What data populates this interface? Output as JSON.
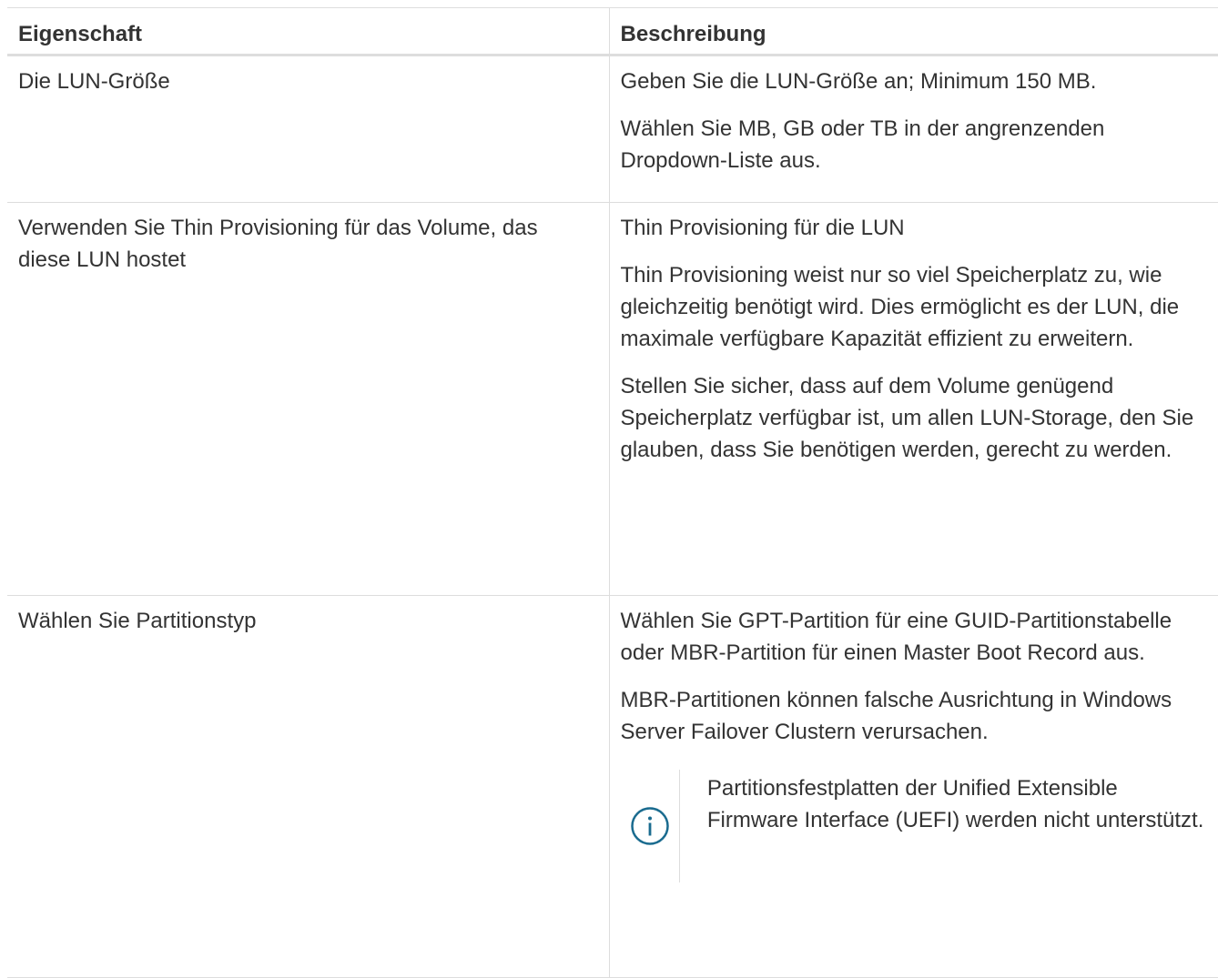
{
  "table": {
    "headers": [
      "Eigenschaft",
      "Beschreibung"
    ],
    "rows": [
      {
        "property": "Die LUN-Größe",
        "description": [
          "Geben Sie die LUN-Größe an; Minimum 150 MB.",
          "Wählen Sie MB, GB oder TB in der angrenzenden Dropdown-Liste aus."
        ]
      },
      {
        "property": "Verwenden Sie Thin Provisioning für das Volume, das diese LUN hostet",
        "description": [
          "Thin Provisioning für die LUN",
          "Thin Provisioning weist nur so viel Speicherplatz zu, wie gleichzeitig benötigt wird. Dies ermöglicht es der LUN, die maximale verfügbare Kapazität effizient zu erweitern.",
          "Stellen Sie sicher, dass auf dem Volume genügend Speicherplatz verfügbar ist, um allen LUN-Storage, den Sie glauben, dass Sie benötigen werden, gerecht zu werden."
        ]
      },
      {
        "property": "Wählen Sie Partitionstyp",
        "description": [
          "Wählen Sie GPT-Partition für eine GUID-Partitionstabelle oder MBR-Partition für einen Master Boot Record aus.",
          "MBR-Partitionen können falsche Ausrichtung in Windows Server Failover Clustern verursachen."
        ],
        "note": {
          "icon": "info-icon",
          "text": "Partitionsfestplatten der Unified Extensible Firmware Interface (UEFI) werden nicht unterstützt."
        }
      }
    ]
  },
  "colors": {
    "text": "#333333",
    "border": "#dddddd",
    "info_icon": "#1a6b8f"
  }
}
